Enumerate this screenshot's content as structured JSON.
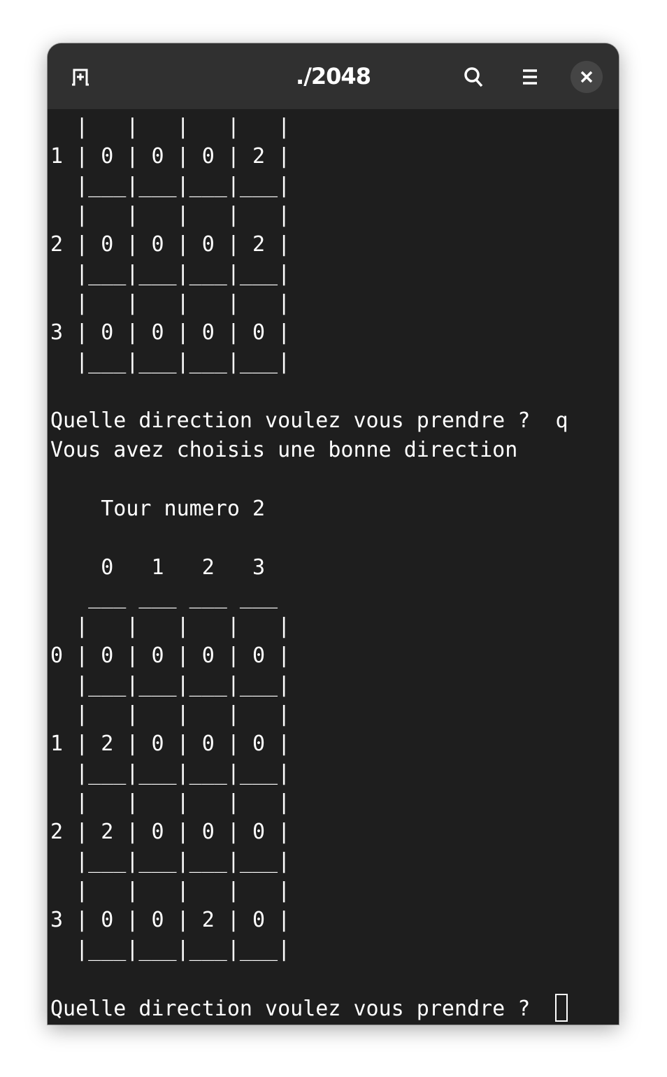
{
  "window": {
    "title": "./2048"
  },
  "header": {
    "icons": [
      "new-tab-icon",
      "search-icon",
      "menu-icon",
      "close-icon"
    ]
  },
  "terminal": {
    "lines": [
      "  |   |   |   |   |",
      "1 | 0 | 0 | 0 | 2 |",
      "  |___|___|___|___|",
      "  |   |   |   |   |",
      "2 | 0 | 0 | 0 | 2 |",
      "  |___|___|___|___|",
      "  |   |   |   |   |",
      "3 | 0 | 0 | 0 | 0 |",
      "  |___|___|___|___|",
      "",
      "Quelle direction voulez vous prendre ?  q",
      "Vous avez choisis une bonne direction",
      "",
      "    Tour numero 2",
      "",
      "    0   1   2   3",
      "   ___ ___ ___ ___",
      "  |   |   |   |   |",
      "0 | 0 | 0 | 0 | 0 |",
      "  |___|___|___|___|",
      "  |   |   |   |   |",
      "1 | 2 | 0 | 0 | 0 |",
      "  |___|___|___|___|",
      "  |   |   |   |   |",
      "2 | 2 | 0 | 0 | 0 |",
      "  |___|___|___|___|",
      "  |   |   |   |   |",
      "3 | 0 | 0 | 2 | 0 |",
      "  |___|___|___|___|",
      ""
    ],
    "prompt": "Quelle direction voulez vous prendre ? "
  }
}
